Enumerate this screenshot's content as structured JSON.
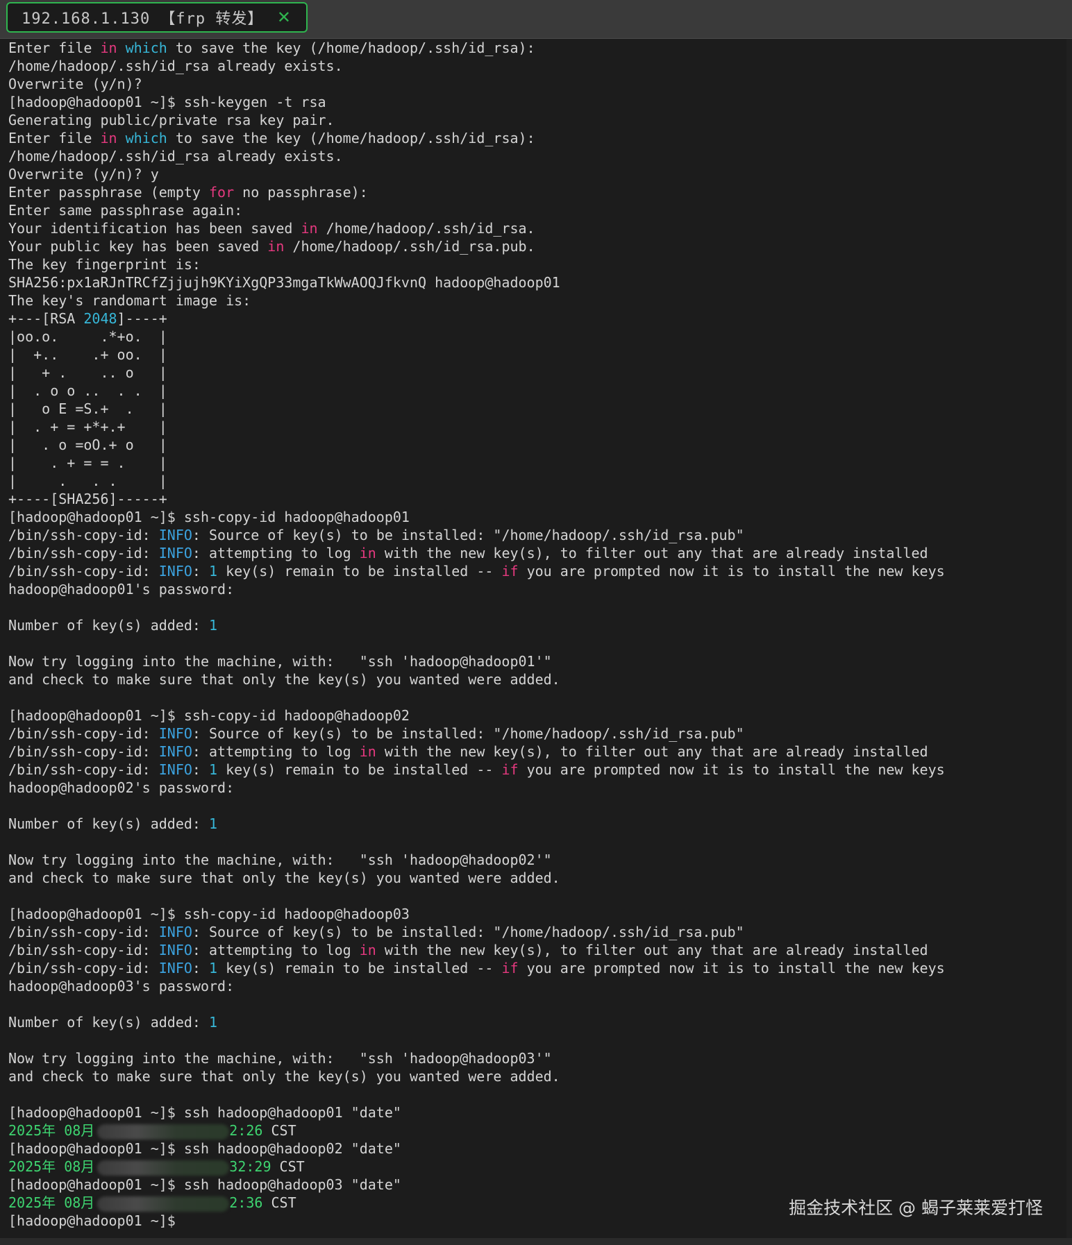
{
  "tab": {
    "title": "192.168.1.130 【frp 转发】",
    "close_symbol": "✕"
  },
  "watermark": "掘金技术社区 @ 蝎子莱莱爱打怪",
  "colors": {
    "keyword": "#e5397f",
    "cyan": "#37b7d8",
    "info": "#3ca3e0",
    "green": "#3ed470",
    "tab_accent": "#2fb54f"
  },
  "terminal": {
    "lines": [
      [
        [
          "Enter file ",
          ""
        ],
        [
          "in",
          "kw"
        ],
        [
          " ",
          ""
        ],
        [
          "which",
          "cyan"
        ],
        [
          " to save the key (/home/hadoop/.ssh/id_rsa):",
          ""
        ]
      ],
      [
        [
          "/home/hadoop/.ssh/id_rsa already exists.",
          ""
        ]
      ],
      [
        [
          "Overwrite (y/n)?",
          ""
        ]
      ],
      [
        [
          "[hadoop@hadoop01 ~]$ ssh-keygen -t rsa",
          ""
        ]
      ],
      [
        [
          "Generating public/private rsa key pair.",
          ""
        ]
      ],
      [
        [
          "Enter file ",
          ""
        ],
        [
          "in",
          "kw"
        ],
        [
          " ",
          ""
        ],
        [
          "which",
          "cyan"
        ],
        [
          " to save the key (/home/hadoop/.ssh/id_rsa):",
          ""
        ]
      ],
      [
        [
          "/home/hadoop/.ssh/id_rsa already exists.",
          ""
        ]
      ],
      [
        [
          "Overwrite (y/n)? y",
          ""
        ]
      ],
      [
        [
          "Enter passphrase (empty ",
          ""
        ],
        [
          "for",
          "kw"
        ],
        [
          " no passphrase):",
          ""
        ]
      ],
      [
        [
          "Enter same passphrase again:",
          ""
        ]
      ],
      [
        [
          "Your identification has been saved ",
          ""
        ],
        [
          "in",
          "kw"
        ],
        [
          " /home/hadoop/.ssh/id_rsa.",
          ""
        ]
      ],
      [
        [
          "Your public key has been saved ",
          ""
        ],
        [
          "in",
          "kw"
        ],
        [
          " /home/hadoop/.ssh/id_rsa.pub.",
          ""
        ]
      ],
      [
        [
          "The key fingerprint is:",
          ""
        ]
      ],
      [
        [
          "SHA256:px1aRJnTRCfZjjujh9KYiXgQP33mgaTkWwAOQJfkvnQ hadoop@hadoop01",
          ""
        ]
      ],
      [
        [
          "The key's randomart image is:",
          ""
        ]
      ],
      [
        [
          "+---[RSA ",
          ""
        ],
        [
          "2048",
          "cyan"
        ],
        [
          "]----+",
          ""
        ]
      ],
      [
        [
          "|oo.o.     .*+o.  |",
          ""
        ]
      ],
      [
        [
          "|  +..    .+ oo.  |",
          ""
        ]
      ],
      [
        [
          "|   + .    .. o   |",
          ""
        ]
      ],
      [
        [
          "|  . o o ..  . .  |",
          ""
        ]
      ],
      [
        [
          "|   o E =S.+  .   |",
          ""
        ]
      ],
      [
        [
          "|  . + = +*+.+    |",
          ""
        ]
      ],
      [
        [
          "|   . o =oO.+ o   |",
          ""
        ]
      ],
      [
        [
          "|    . + = = .    |",
          ""
        ]
      ],
      [
        [
          "|     .   . .     |",
          ""
        ]
      ],
      [
        [
          "+----[SHA256]-----+",
          ""
        ]
      ],
      [
        [
          "[hadoop@hadoop01 ~]$ ssh-copy-id hadoop@hadoop01",
          ""
        ]
      ],
      [
        [
          "/bin/ssh-copy-id: ",
          ""
        ],
        [
          "INFO",
          "info"
        ],
        [
          ": Source of key(s) to be installed: \"/home/hadoop/.ssh/id_rsa.pub\"",
          ""
        ]
      ],
      [
        [
          "/bin/ssh-copy-id: ",
          ""
        ],
        [
          "INFO",
          "info"
        ],
        [
          ": attempting to log ",
          ""
        ],
        [
          "in",
          "kw"
        ],
        [
          " with the new key(s), to filter out any that are already installed",
          ""
        ]
      ],
      [
        [
          "/bin/ssh-copy-id: ",
          ""
        ],
        [
          "INFO",
          "info"
        ],
        [
          ": ",
          ""
        ],
        [
          "1",
          "cyan"
        ],
        [
          " key(s) remain to be installed -- ",
          ""
        ],
        [
          "if",
          "kw"
        ],
        [
          " you are prompted now it is to install the new keys",
          ""
        ]
      ],
      [
        [
          "hadoop@hadoop01's password:",
          ""
        ]
      ],
      [],
      [
        [
          "Number of key(s) added: ",
          ""
        ],
        [
          "1",
          "cyan"
        ]
      ],
      [],
      [
        [
          "Now try logging into the machine, with:   \"ssh 'hadoop@hadoop01'\"",
          ""
        ]
      ],
      [
        [
          "and check to make sure that only the key(s) you wanted were added.",
          ""
        ]
      ],
      [],
      [
        [
          "[hadoop@hadoop01 ~]$ ssh-copy-id hadoop@hadoop02",
          ""
        ]
      ],
      [
        [
          "/bin/ssh-copy-id: ",
          ""
        ],
        [
          "INFO",
          "info"
        ],
        [
          ": Source of key(s) to be installed: \"/home/hadoop/.ssh/id_rsa.pub\"",
          ""
        ]
      ],
      [
        [
          "/bin/ssh-copy-id: ",
          ""
        ],
        [
          "INFO",
          "info"
        ],
        [
          ": attempting to log ",
          ""
        ],
        [
          "in",
          "kw"
        ],
        [
          " with the new key(s), to filter out any that are already installed",
          ""
        ]
      ],
      [
        [
          "/bin/ssh-copy-id: ",
          ""
        ],
        [
          "INFO",
          "info"
        ],
        [
          ": ",
          ""
        ],
        [
          "1",
          "cyan"
        ],
        [
          " key(s) remain to be installed -- ",
          ""
        ],
        [
          "if",
          "kw"
        ],
        [
          " you are prompted now it is to install the new keys",
          ""
        ]
      ],
      [
        [
          "hadoop@hadoop02's password:",
          ""
        ]
      ],
      [],
      [
        [
          "Number of key(s) added: ",
          ""
        ],
        [
          "1",
          "cyan"
        ]
      ],
      [],
      [
        [
          "Now try logging into the machine, with:   \"ssh 'hadoop@hadoop02'\"",
          ""
        ]
      ],
      [
        [
          "and check to make sure that only the key(s) you wanted were added.",
          ""
        ]
      ],
      [],
      [
        [
          "[hadoop@hadoop01 ~]$ ssh-copy-id hadoop@hadoop03",
          ""
        ]
      ],
      [
        [
          "/bin/ssh-copy-id: ",
          ""
        ],
        [
          "INFO",
          "info"
        ],
        [
          ": Source of key(s) to be installed: \"/home/hadoop/.ssh/id_rsa.pub\"",
          ""
        ]
      ],
      [
        [
          "/bin/ssh-copy-id: ",
          ""
        ],
        [
          "INFO",
          "info"
        ],
        [
          ": attempting to log ",
          ""
        ],
        [
          "in",
          "kw"
        ],
        [
          " with the new key(s), to filter out any that are already installed",
          ""
        ]
      ],
      [
        [
          "/bin/ssh-copy-id: ",
          ""
        ],
        [
          "INFO",
          "info"
        ],
        [
          ": ",
          ""
        ],
        [
          "1",
          "cyan"
        ],
        [
          " key(s) remain to be installed -- ",
          ""
        ],
        [
          "if",
          "kw"
        ],
        [
          " you are prompted now it is to install the new keys",
          ""
        ]
      ],
      [
        [
          "hadoop@hadoop03's password:",
          ""
        ]
      ],
      [],
      [
        [
          "Number of key(s) added: ",
          ""
        ],
        [
          "1",
          "cyan"
        ]
      ],
      [],
      [
        [
          "Now try logging into the machine, with:   \"ssh 'hadoop@hadoop03'\"",
          ""
        ]
      ],
      [
        [
          "and check to make sure that only the key(s) you wanted were added.",
          ""
        ]
      ],
      [],
      [
        [
          "[hadoop@hadoop01 ~]$ ssh hadoop@hadoop01 \"date\"",
          ""
        ]
      ],
      [
        [
          "2025年 08月",
          "green"
        ],
        [
          "",
          "blur"
        ],
        [
          "2:26",
          "green"
        ],
        [
          " CST",
          ""
        ]
      ],
      [
        [
          "[hadoop@hadoop01 ~]$ ssh hadoop@hadoop02 \"date\"",
          ""
        ]
      ],
      [
        [
          "2025年 08月",
          "green"
        ],
        [
          "",
          "blur"
        ],
        [
          "32:29",
          "green"
        ],
        [
          " CST",
          ""
        ]
      ],
      [
        [
          "[hadoop@hadoop01 ~]$ ssh hadoop@hadoop03 \"date\"",
          ""
        ]
      ],
      [
        [
          "2025年 08月",
          "green"
        ],
        [
          "",
          "blur"
        ],
        [
          "2:36",
          "green"
        ],
        [
          " CST",
          ""
        ]
      ],
      [
        [
          "[hadoop@hadoop01 ~]$",
          ""
        ]
      ]
    ]
  }
}
